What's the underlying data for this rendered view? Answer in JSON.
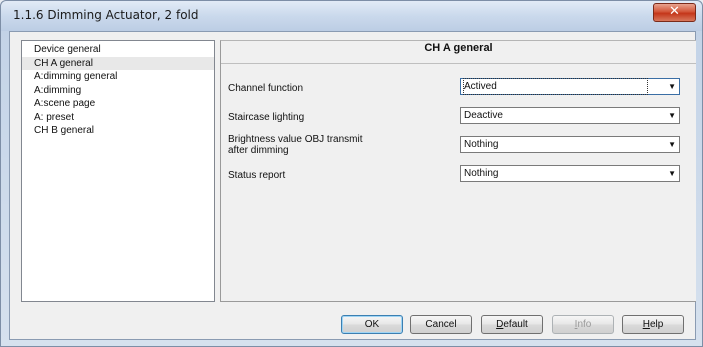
{
  "window": {
    "title": "1.1.6 Dimming Actuator, 2 fold",
    "close_glyph": "✕"
  },
  "tree": {
    "items": [
      {
        "label": "Device general",
        "selected": false
      },
      {
        "label": "CH A general",
        "selected": true
      },
      {
        "label": "A:dimming general",
        "selected": false
      },
      {
        "label": "A:dimming",
        "selected": false
      },
      {
        "label": "A:scene page",
        "selected": false
      },
      {
        "label": "A: preset",
        "selected": false
      },
      {
        "label": "CH B general",
        "selected": false
      }
    ]
  },
  "panel": {
    "title": "CH A general",
    "rows": [
      {
        "label": "Channel function",
        "value": "Actived"
      },
      {
        "label": "Staircase lighting",
        "value": "Deactive"
      },
      {
        "label_line1": "Brightness value OBJ transmit",
        "label_line2": "after dimming",
        "value": "Nothing"
      },
      {
        "label": "Status report",
        "value": "Nothing"
      }
    ]
  },
  "buttons": {
    "ok": "OK",
    "cancel": "Cancel",
    "default_pre": "",
    "default_u": "D",
    "default_post": "efault",
    "info_u": "I",
    "info_post": "nfo",
    "help_u": "H",
    "help_post": "elp"
  },
  "icons": {
    "dropdown": "▼"
  },
  "colors": {
    "title_bar": "#c8d8ec",
    "close_button": "#c9442a",
    "selected_tree_item": "#e8e8e8"
  }
}
